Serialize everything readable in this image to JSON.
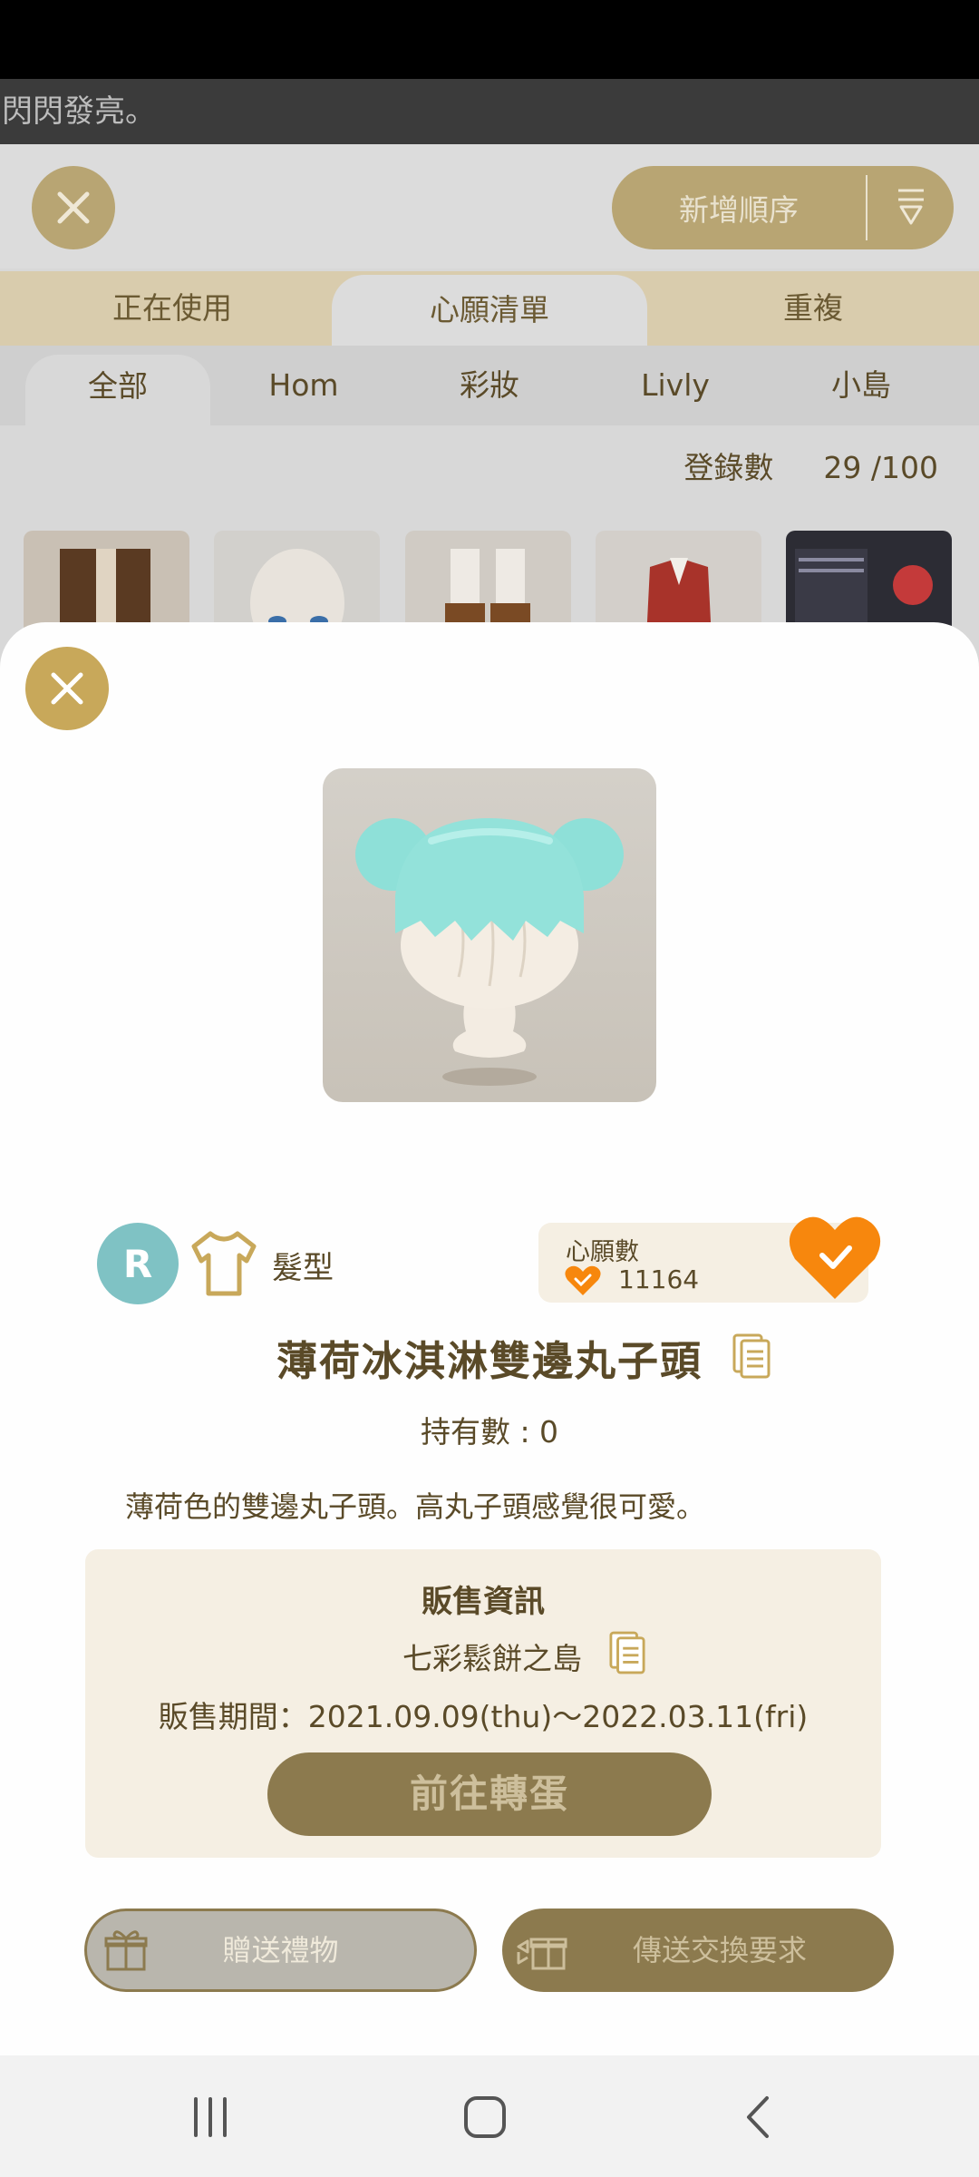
{
  "notice": {
    "text": "閃閃發亮。"
  },
  "background": {
    "sort_label": "新增順序",
    "tabs": [
      {
        "label": "正在使用",
        "active": false
      },
      {
        "label": "心願清單",
        "active": true
      },
      {
        "label": "重複",
        "active": false
      }
    ],
    "subtabs": [
      {
        "label": "全部",
        "active": true
      },
      {
        "label": "Hom",
        "active": false
      },
      {
        "label": "彩妝",
        "active": false
      },
      {
        "label": "Livly",
        "active": false
      },
      {
        "label": "小島",
        "active": false
      }
    ],
    "count_label": "登錄數",
    "count_value": "29 /100"
  },
  "item": {
    "rarity": "R",
    "category": "髮型",
    "wish_label": "心願數",
    "wish_count": "11164",
    "name": "薄荷冰淇淋雙邊丸子頭",
    "owned": "持有數 : 0",
    "description": "薄荷色的雙邊丸子頭。高丸子頭感覺很可愛。"
  },
  "sale": {
    "title": "販售資訊",
    "island": "七彩鬆餅之島",
    "period": "販售期間：2021.09.09(thu)～2022.03.11(fri)",
    "goto_label": "前往轉蛋"
  },
  "actions": {
    "gift_label": "贈送禮物",
    "trade_label": "傳送交換要求"
  },
  "colors": {
    "accent_gold": "#c8a85a",
    "brown_text": "#5a4a28",
    "heart_orange": "#f7870d",
    "rarity_teal": "#7fc2c4"
  }
}
